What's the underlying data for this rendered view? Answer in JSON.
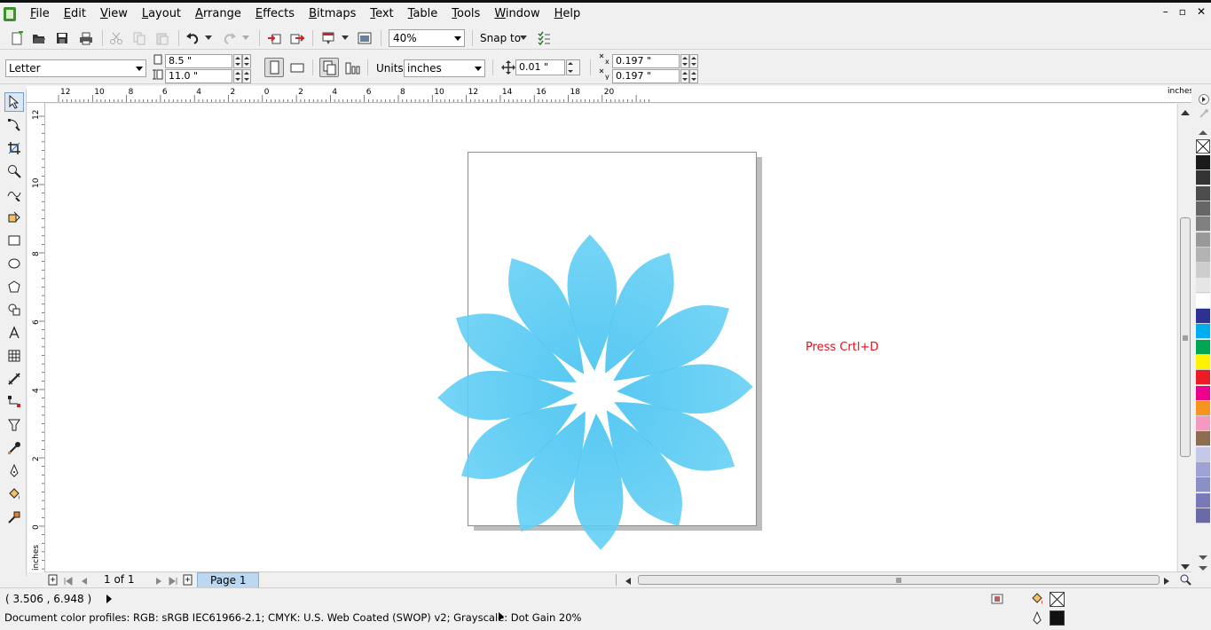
{
  "menu": {
    "items": [
      {
        "label": "File",
        "mnemonic": "F",
        "rest": "ile"
      },
      {
        "label": "Edit",
        "mnemonic": "E",
        "rest": "dit"
      },
      {
        "label": "View",
        "mnemonic": "V",
        "rest": "iew"
      },
      {
        "label": "Layout",
        "mnemonic": "L",
        "rest": "ayout"
      },
      {
        "label": "Arrange",
        "mnemonic": "A",
        "rest": "rrange"
      },
      {
        "label": "Effects",
        "mnemonic": "E",
        "rest": "ffects"
      },
      {
        "label": "Bitmaps",
        "mnemonic": "B",
        "rest": "itmaps"
      },
      {
        "label": "Text",
        "mnemonic": "T",
        "rest": "ext"
      },
      {
        "label": "Table",
        "mnemonic": "T",
        "rest": "able"
      },
      {
        "label": "Tools",
        "mnemonic": "T",
        "rest": "ools"
      },
      {
        "label": "Window",
        "mnemonic": "W",
        "rest": "indow"
      },
      {
        "label": "Help",
        "mnemonic": "H",
        "rest": "elp"
      }
    ],
    "window_controls": [
      "–",
      "▫",
      "✕"
    ]
  },
  "toolbar": {
    "zoom": "40%",
    "snap_to": "Snap to"
  },
  "property_bar": {
    "paper": "Letter",
    "width": "8.5 \"",
    "height": "11.0 \"",
    "units_label": "Units:",
    "units": "inches",
    "nudge": "0.01 \"",
    "dup_x": "0.197 \"",
    "dup_y": "0.197 \""
  },
  "ruler": {
    "h_labels": [
      "12",
      "10",
      "8",
      "6",
      "4",
      "2",
      "0",
      "2",
      "4",
      "6",
      "8",
      "10",
      "12",
      "14",
      "16",
      "18",
      "20"
    ],
    "h_unit": "inches",
    "v_labels": [
      "12",
      "10",
      "8",
      "6",
      "4",
      "2",
      "0"
    ],
    "v_unit": "inches"
  },
  "canvas": {
    "hint": "Press Crtl+D",
    "flower_color": "#47c3f1"
  },
  "page_nav": {
    "count": "1 of 1",
    "tab": "Page 1"
  },
  "palette": {
    "colors": [
      "#1a1a1a",
      "#333333",
      "#4d4d4d",
      "#666666",
      "#808080",
      "#999999",
      "#b3b3b3",
      "#cccccc",
      "#e6e6e6",
      "#ffffff",
      "#2e3192",
      "#00aeef",
      "#00a651",
      "#fff200",
      "#ed1c24",
      "#ec008c",
      "#f7941d",
      "#f49ac1",
      "#8c6d4f",
      "#c5c8e8",
      "#9fa3d4",
      "#8b8fc7",
      "#7779b8",
      "#6a6aa9"
    ]
  },
  "status": {
    "coords": "( 3.506 , 6.948  )",
    "profiles": "Document color profiles: RGB: sRGB IEC61966-2.1; CMYK: U.S. Web Coated (SWOP) v2; Grayscale: Dot Gain 20%"
  }
}
